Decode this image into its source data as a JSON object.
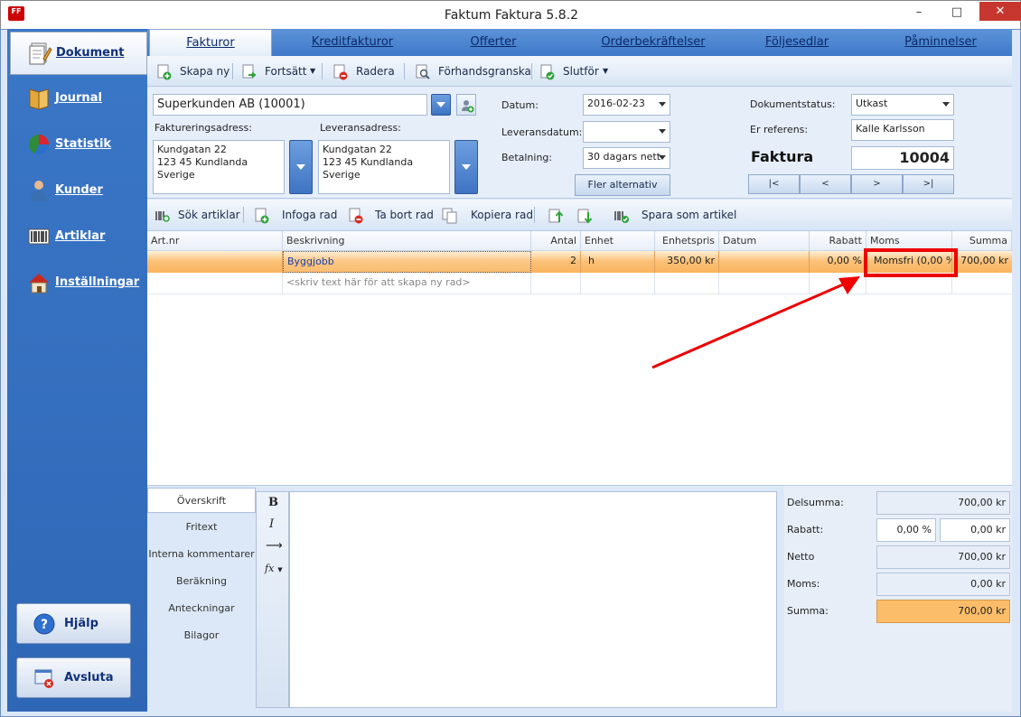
{
  "window": {
    "title": "Faktum Faktura 5.8.2",
    "icon_text": "FF",
    "minimize": "–",
    "maximize": "□",
    "close": "✕"
  },
  "sidebar": {
    "items": [
      {
        "label": "Dokument",
        "icon": "document-icon"
      },
      {
        "label": "Journal",
        "icon": "journal-icon"
      },
      {
        "label": "Statistik",
        "icon": "pie-chart-icon"
      },
      {
        "label": "Kunder",
        "icon": "customer-icon"
      },
      {
        "label": "Artiklar",
        "icon": "barcode-icon"
      },
      {
        "label": "Inställningar",
        "icon": "house-settings-icon"
      }
    ],
    "help_label": "Hjälp",
    "exit_label": "Avsluta"
  },
  "tabs": [
    "Fakturor",
    "Kreditfakturor",
    "Offerter",
    "Orderbekräftelser",
    "Följesedlar",
    "Påminnelser"
  ],
  "toolbar": {
    "create": "Skapa ny",
    "continue": "Fortsätt",
    "delete": "Radera",
    "preview": "Förhandsgranska",
    "finish": "Slutför"
  },
  "form": {
    "customer": "Superkunden AB (10001)",
    "billing_label": "Faktureringsadress:",
    "billing_address": [
      "Kundgatan 22",
      "123 45 Kundlanda",
      "Sverige"
    ],
    "delivery_label": "Leveransadress:",
    "delivery_address": [
      "Kundgatan 22",
      "123 45 Kundlanda",
      "Sverige"
    ],
    "date_label": "Datum:",
    "date": "2016-02-23",
    "delivery_date_label": "Leveransdatum:",
    "delivery_date": "",
    "payment_label": "Betalning:",
    "payment": "30 dagars nett",
    "more_options": "Fler alternativ",
    "status_label": "Dokumentstatus:",
    "status": "Utkast",
    "reference_label": "Er referens:",
    "reference": "Kalle Karlsson",
    "doc_type": "Faktura",
    "doc_number": "10004",
    "nav": [
      "|<",
      "<",
      ">",
      ">|"
    ]
  },
  "rows_toolbar": {
    "search": "Sök artiklar",
    "insert": "Infoga rad",
    "remove": "Ta bort rad",
    "copy": "Kopiera rad",
    "save_article": "Spara som artikel"
  },
  "grid": {
    "headers": [
      "Art.nr",
      "Beskrivning",
      "Antal",
      "Enhet",
      "Enhetspris",
      "Datum",
      "Rabatt",
      "Moms",
      "Summa"
    ],
    "row": {
      "artnr": "",
      "description": "Byggjobb",
      "qty": "2",
      "unit": "h",
      "unit_price": "350,00 kr",
      "date": "",
      "discount": "0,00 %",
      "vat": "Momsfri (0,00 %",
      "sum": "700,00 kr"
    },
    "new_row_placeholder": "<skriv text här för att skapa ny rad>"
  },
  "lower_tabs": [
    "Överskrift",
    "Fritext",
    "Interna kommentarer",
    "Beräkning",
    "Anteckningar",
    "Bilagor"
  ],
  "editor_tools": {
    "bold": "B",
    "italic": "I",
    "indent": "⟶",
    "fx": "fx"
  },
  "totals": {
    "subtotal_label": "Delsumma:",
    "subtotal": "700,00 kr",
    "discount_label": "Rabatt:",
    "discount_pct": "0,00 %",
    "discount_amount": "0,00 kr",
    "net_label": "Netto",
    "net": "700,00 kr",
    "vat_label": "Moms:",
    "vat": "0,00 kr",
    "total_label": "Summa:",
    "total": "700,00 kr"
  },
  "colors": {
    "accent": "#3b77c7",
    "row_highlight": "#fab45f",
    "annotation": "#e00000"
  }
}
